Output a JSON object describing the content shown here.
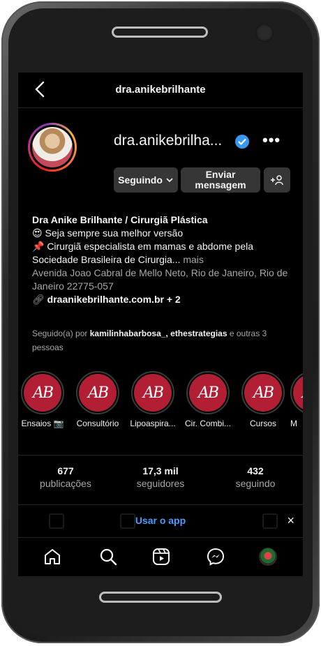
{
  "header": {
    "title": "dra.anikebrilhante"
  },
  "profile": {
    "username": "dra.anikebrilha...",
    "buttons": {
      "follow": "Seguindo",
      "message": "Enviar mensagem",
      "add_user": "+"
    },
    "bio": {
      "name": "Dra Anike Brilhante / Cirurgiã Plástica",
      "line1": "😍 Seja sempre sua melhor versão",
      "line2": "📌 Cirurgiã especialista em mamas e abdome pela Sociedade Brasileira de Cirurgia...",
      "more": "mais",
      "address": "Avenida Joao Cabral de Mello Neto, Rio de Janeiro, Rio de Janeiro 22775-057",
      "link": "draanikebrilhante.com.br + 2"
    },
    "followed_by": {
      "prefix": "Seguido(a) por",
      "user1": "kamilinhabarbosa_",
      "sep": ",",
      "user2": "ethestrategias",
      "suffix": "e outras 3 pessoas"
    }
  },
  "highlights": [
    {
      "label": "Ensaios 📷"
    },
    {
      "label": "Consultório"
    },
    {
      "label": "Lipoaspira..."
    },
    {
      "label": "Cir. Combi..."
    },
    {
      "label": "Cursos"
    },
    {
      "label": "M"
    }
  ],
  "highlight_logo": "AB",
  "stats": {
    "posts": {
      "value": "677",
      "label": "publicações"
    },
    "followers": {
      "value": "17,3 mil",
      "label": "seguidores"
    },
    "following": {
      "value": "432",
      "label": "seguindo"
    }
  },
  "banner": {
    "use_app": "Usar o app",
    "close": "×"
  },
  "colors": {
    "accent": "#4a9cff",
    "highlight_bg": "#b21f35",
    "verified": "#3897f0"
  }
}
